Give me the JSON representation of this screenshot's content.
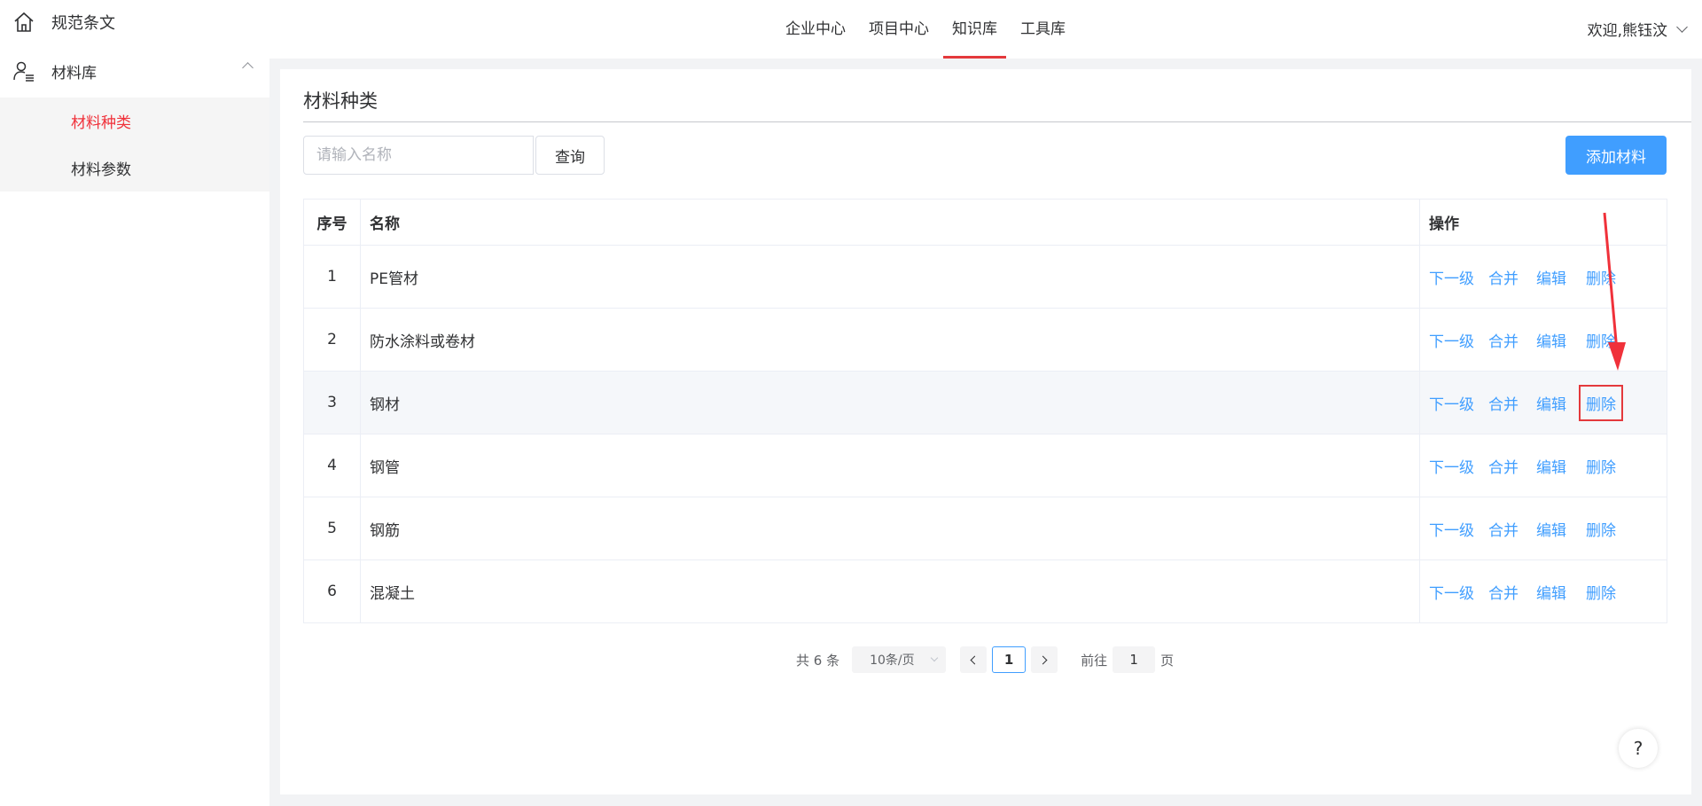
{
  "sidebar": {
    "top_item": {
      "label": "规范条文",
      "icon": "home-icon"
    },
    "group": {
      "label": "材料库",
      "icon": "user-list-icon",
      "expanded": true
    },
    "sub_items": [
      {
        "label": "材料种类",
        "active": true
      },
      {
        "label": "材料参数",
        "active": false
      }
    ]
  },
  "topnav": {
    "items": [
      {
        "label": "企业中心",
        "active": false
      },
      {
        "label": "项目中心",
        "active": false
      },
      {
        "label": "知识库",
        "active": true
      },
      {
        "label": "工具库",
        "active": false
      }
    ],
    "welcome": "欢迎,熊钰汶"
  },
  "page": {
    "title": "材料种类",
    "search": {
      "placeholder": "请输入名称",
      "value": "",
      "button": "查询"
    },
    "add_button": "添加材料"
  },
  "table": {
    "headers": {
      "index": "序号",
      "name": "名称",
      "ops": "操作"
    },
    "ops_labels": {
      "sub": "下一级",
      "merge": "合并",
      "edit": "编辑",
      "delete": "删除"
    },
    "rows": [
      {
        "index": "1",
        "name": "PE管材"
      },
      {
        "index": "2",
        "name": "防水涂料或卷材"
      },
      {
        "index": "3",
        "name": "钢材",
        "highlighted": true
      },
      {
        "index": "4",
        "name": "钢管"
      },
      {
        "index": "5",
        "name": "钢筋"
      },
      {
        "index": "6",
        "name": "混凝土"
      }
    ]
  },
  "pager": {
    "total": "共 6 条",
    "page_size": "10条/页",
    "current_page": "1",
    "goto_label": "前往",
    "goto_value": "1",
    "page_unit": "页"
  },
  "help": "?",
  "colors": {
    "accent": "#409eff",
    "active_red": "#e4393c",
    "annotation": "#e4393c"
  }
}
